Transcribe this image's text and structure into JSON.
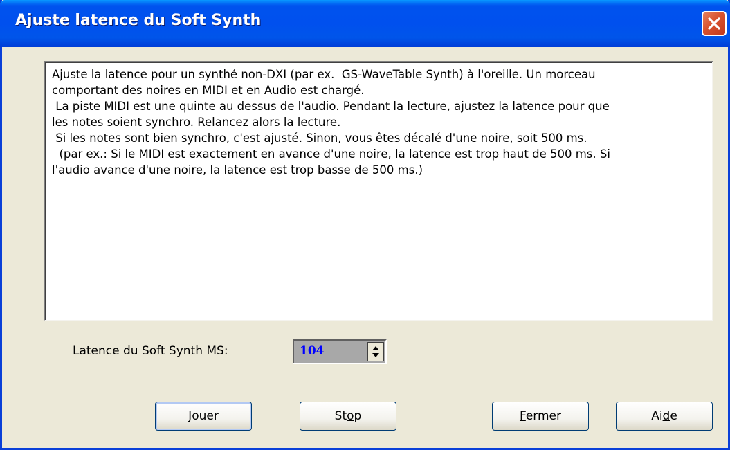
{
  "window": {
    "title": "Ajuste latence du Soft Synth",
    "close_icon": "close-icon"
  },
  "description": {
    "text": "Ajuste la latence pour un synthé non-DXI (par ex.  GS-WaveTable Synth) à l'oreille. Un morceau\ncomportant des noires en MIDI et en Audio est chargé.\n La piste MIDI est une quinte au dessus de l'audio. Pendant la lecture, ajustez la latence pour que\nles notes soient synchro. Relancez alors la lecture.\n Si les notes sont bien synchro, c'est ajusté. Sinon, vous êtes décalé d'une noire, soit 500 ms.\n  (par ex.: Si le MIDI est exactement en avance d'une noire, la latence est trop haut de 500 ms. Si\nl'audio avance d'une noire, la latence est trop basse de 500 ms.)"
  },
  "latency": {
    "label": "Latence du Soft Synth MS:",
    "value": "104",
    "value_color": "#0000ff"
  },
  "buttons": {
    "play": {
      "pre": "",
      "key": "J",
      "post": "ouer"
    },
    "stop": {
      "pre": "St",
      "key": "o",
      "post": "p"
    },
    "close": {
      "pre": "",
      "key": "F",
      "post": "ermer"
    },
    "help": {
      "pre": "Ai",
      "key": "d",
      "post": "e"
    }
  },
  "colors": {
    "titlebar": "#0053ee",
    "dialog_bg": "#ece9d8",
    "close_button": "#d8522f"
  }
}
